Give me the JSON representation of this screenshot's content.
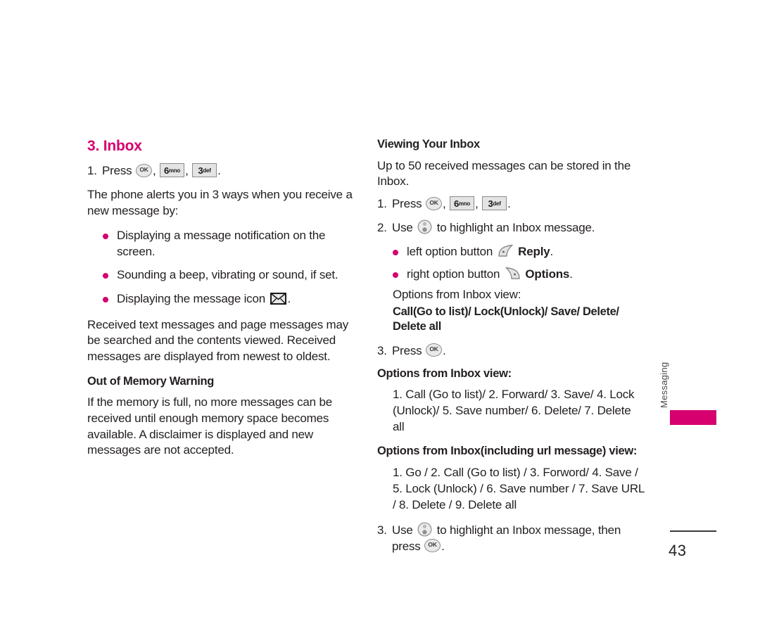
{
  "document": {
    "page_number": "43",
    "side_tab_label": "Messaging",
    "accent_color": "#d6006e",
    "text_color": "#231f20"
  },
  "left_column": {
    "section_title": "3. Inbox",
    "step1": {
      "number": "1.",
      "press_label": "Press",
      "keys": [
        {
          "icon": "ok-key-icon",
          "label": "OK"
        },
        {
          "icon": "numeric-key-icon",
          "digit": "6",
          "letters": "mno"
        },
        {
          "icon": "numeric-key-icon",
          "digit": "3",
          "letters": "def"
        }
      ],
      "trailing": "."
    },
    "intro_paragraph": "The phone alerts you in 3 ways when you receive a new message by:",
    "alert_bullets": [
      "Displaying a message notification on the screen.",
      "Sounding a beep, vibrating or sound, if set.",
      "Displaying the message icon"
    ],
    "alert_bullet3_trailing": ".",
    "received_paragraph": "Received text messages and page messages may be searched and the contents viewed. Received messages are displayed from newest to oldest.",
    "out_of_memory_heading": "Out of Memory Warning",
    "out_of_memory_paragraph": "If the memory is full, no more messages can be received until enough memory space becomes available. A disclaimer is displayed and new messages are not accepted."
  },
  "right_column": {
    "viewing_heading": "Viewing Your Inbox",
    "viewing_paragraph": "Up to 50 received messages can be stored in the Inbox.",
    "step1": {
      "number": "1.",
      "press_label": "Press",
      "keys": [
        {
          "icon": "ok-key-icon",
          "label": "OK"
        },
        {
          "icon": "numeric-key-icon",
          "digit": "6",
          "letters": "mno"
        },
        {
          "icon": "numeric-key-icon",
          "digit": "3",
          "letters": "def"
        }
      ],
      "trailing": "."
    },
    "step2": {
      "number": "2.",
      "use_label": "Use",
      "after_nav_key": "to highlight an Inbox message."
    },
    "option_bullets": [
      {
        "prefix": "left option button",
        "icon": "left-soft-key-icon",
        "bold": "Reply",
        "suffix": "."
      },
      {
        "prefix": "right option button",
        "icon": "right-soft-key-icon",
        "bold": "Options",
        "suffix": "."
      }
    ],
    "options_from_inbox_note": "Options from Inbox view:",
    "options_bold_list": "Call(Go to list)/ Lock(Unlock)/ Save/ Delete/ Delete all",
    "step3": {
      "number": "3.",
      "press_label": "Press",
      "trailing": "."
    },
    "options_inbox_heading": "Options from Inbox view:",
    "options_inbox_list": "1. Call (Go to list)/ 2. Forward/ 3. Save/ 4. Lock (Unlock)/ 5. Save number/ 6. Delete/ 7. Delete all",
    "options_url_heading": "Options from Inbox(including url message) view:",
    "options_url_list": "1. Go / 2. Call (Go to list) / 3. Forword/ 4. Save / 5. Lock (Unlock) / 6. Save number / 7. Save URL / 8. Delete / 9. Delete all",
    "step3b": {
      "number": "3.",
      "use_label": "Use",
      "after_nav_key": "to highlight an Inbox message, then",
      "press_label": "press",
      "trailing": "."
    }
  }
}
